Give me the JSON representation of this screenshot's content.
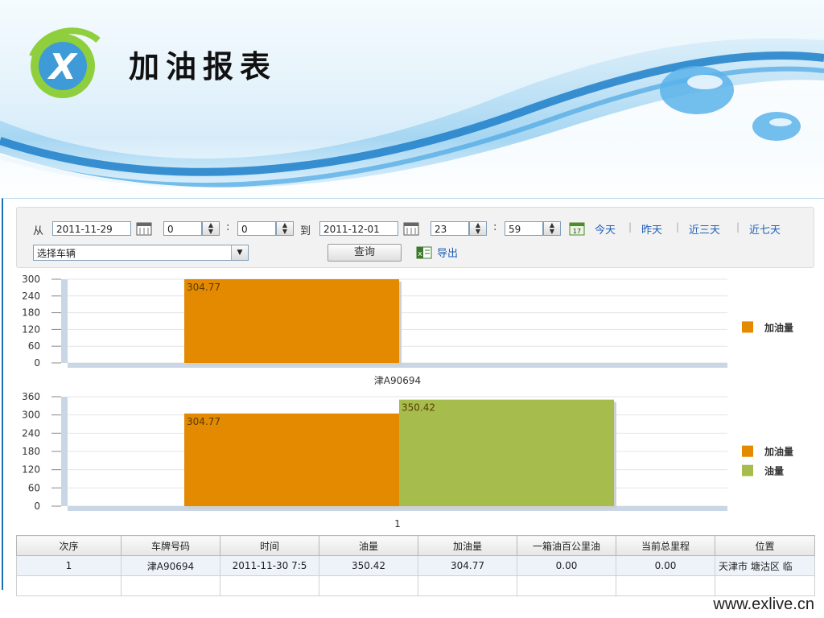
{
  "header": {
    "title": "加油报表",
    "logo_letter": "X"
  },
  "toolbar": {
    "from_label": "从",
    "start_date": "2011-11-29",
    "start_hour": "0",
    "start_minute": "0",
    "to_label": "到",
    "end_date": "2011-12-01",
    "end_hour": "23",
    "end_minute": "59",
    "colon": ":",
    "quick_links": [
      "今天",
      "昨天",
      "近三天",
      "近七天"
    ],
    "vehicle_select": "选择车辆",
    "query_button": "查询",
    "export_link": "导出"
  },
  "chart_data": [
    {
      "type": "bar",
      "categories": [
        "津A90694"
      ],
      "series": [
        {
          "name": "加油量",
          "values": [
            304.77
          ],
          "color": "#e38a00"
        }
      ],
      "xlabel": "津A90694",
      "ylim": [
        0,
        300
      ],
      "yticks": [
        0,
        60,
        120,
        180,
        240,
        300
      ],
      "grid": true,
      "legend": "right"
    },
    {
      "type": "bar",
      "categories": [
        "1"
      ],
      "series": [
        {
          "name": "加油量",
          "values": [
            304.77
          ],
          "color": "#e38a00"
        },
        {
          "name": "油量",
          "values": [
            350.42
          ],
          "color": "#a6bd4e"
        }
      ],
      "xlabel": "1",
      "ylim": [
        0,
        360
      ],
      "yticks": [
        0,
        60,
        120,
        180,
        240,
        300,
        360
      ],
      "grid": true,
      "legend": "right"
    }
  ],
  "table": {
    "columns": [
      "次序",
      "车牌号码",
      "时间",
      "油量",
      "加油量",
      "一箱油百公里油",
      "当前总里程",
      "位置"
    ],
    "rows": [
      [
        "1",
        "津A90694",
        "2011-11-30 7:5",
        "350.42",
        "304.77",
        "0.00",
        "0.00",
        "天津市 塘沽区 临"
      ]
    ]
  },
  "footer": {
    "url": "www.exlive.cn"
  }
}
